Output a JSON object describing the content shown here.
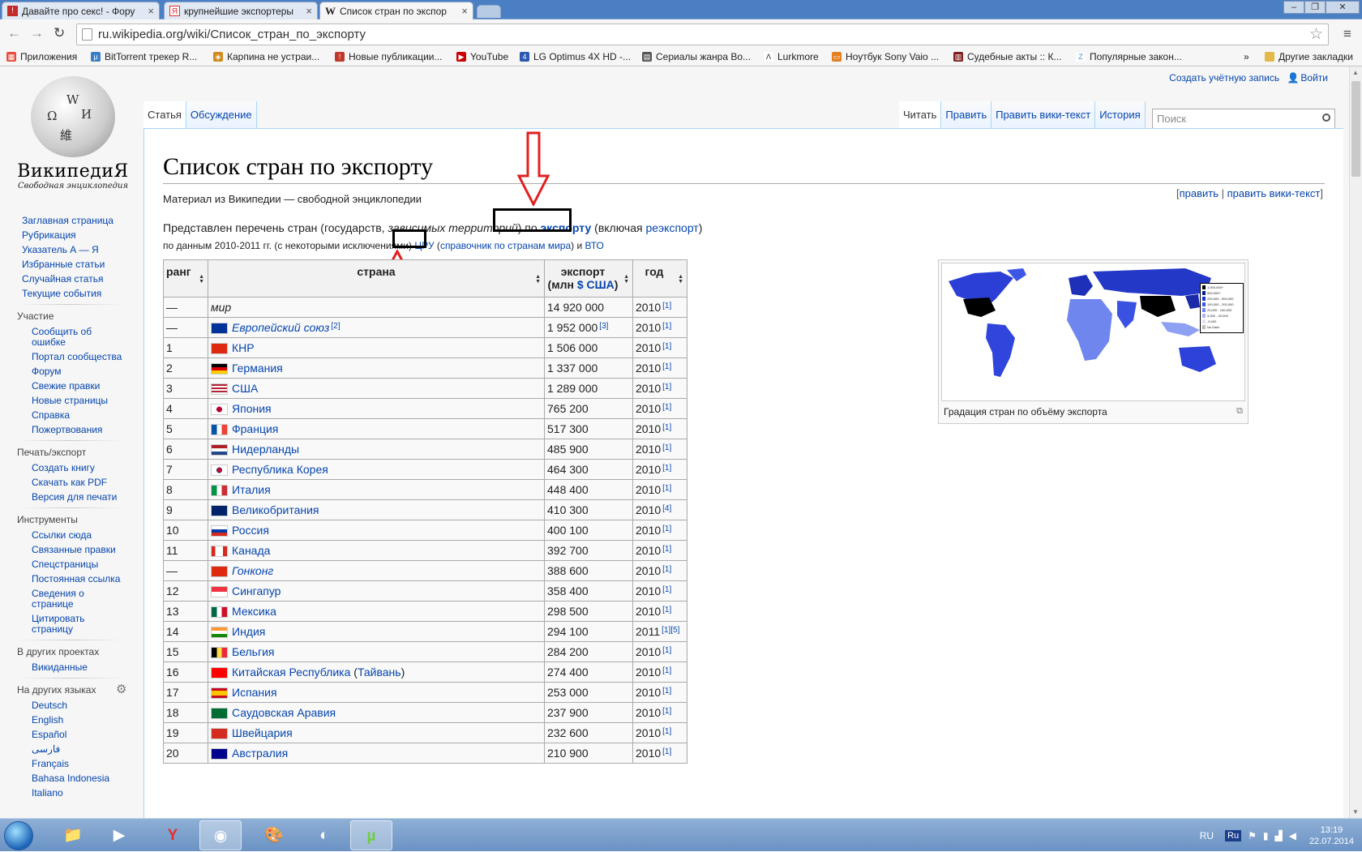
{
  "browser": {
    "tabs": [
      {
        "title": "Давайте про секс! - Фору",
        "icon": "forum-icon",
        "color": "#c42c2c"
      },
      {
        "title": "крупнейшие экспортеры",
        "icon": "yandex-icon",
        "color": "#e62e2e"
      },
      {
        "title": "Список стран по экспор",
        "icon": "wikipedia-icon",
        "color": "#333333"
      }
    ],
    "url": "ru.wikipedia.org/wiki/Список_стран_по_экспорту",
    "bookmarks": [
      {
        "label": "Приложения",
        "color": "#e74c3c"
      },
      {
        "label": "BitTorrent трекер R...",
        "color": "#3a7ec8"
      },
      {
        "label": "Карпина не устраи...",
        "color": "#d08a20"
      },
      {
        "label": "Новые публикации...",
        "color": "#c0392b"
      },
      {
        "label": "YouTube",
        "color": "#cc0000"
      },
      {
        "label": "LG Optimus 4X HD -...",
        "color": "#2a58b0"
      },
      {
        "label": "Сериалы жанра Во...",
        "color": "#555555"
      },
      {
        "label": "Lurkmore",
        "color": "#222222"
      },
      {
        "label": "Ноутбук Sony Vaio ...",
        "color": "#e67e22"
      },
      {
        "label": "Судебные акты :: К...",
        "color": "#7f1d1d"
      },
      {
        "label": "Популярные закон...",
        "color": "#3d8be0"
      }
    ],
    "bookmarks_more": "»",
    "other_bookmarks": "Другие закладки"
  },
  "sidebar": {
    "logo_wordmark": "ВикипедиЯ",
    "logo_tagline": "Свободная энциклопедия",
    "main": [
      "Заглавная страница",
      "Рубрикация",
      "Указатель А — Я",
      "Избранные статьи",
      "Случайная статья",
      "Текущие события"
    ],
    "participation_header": "Участие",
    "participation": [
      "Сообщить об ошибке",
      "Портал сообщества",
      "Форум",
      "Свежие правки",
      "Новые страницы",
      "Справка",
      "Пожертвования"
    ],
    "print_header": "Печать/экспорт",
    "print": [
      "Создать книгу",
      "Скачать как PDF",
      "Версия для печати"
    ],
    "tools_header": "Инструменты",
    "tools": [
      "Ссылки сюда",
      "Связанные правки",
      "Спецстраницы",
      "Постоянная ссылка",
      "Сведения о странице",
      "Цитировать страницу"
    ],
    "other_projects_header": "В других проектах",
    "other_projects": [
      "Викиданные"
    ],
    "languages_header": "На других языках",
    "languages": [
      "Deutsch",
      "English",
      "Español",
      "فارسی",
      "Français",
      "Bahasa Indonesia",
      "Italiano"
    ]
  },
  "header": {
    "create_account": "Создать учётную запись",
    "login": "Войти",
    "tab_article": "Статья",
    "tab_talk": "Обсуждение",
    "tab_read": "Читать",
    "tab_edit": "Править",
    "tab_edit_source": "Править вики-текст",
    "tab_history": "История",
    "search_placeholder": "Поиск"
  },
  "article": {
    "title": "Список стран по экспорту",
    "site_sub": "Материал из Википедии — свободной энциклопедии",
    "edit_open": "[",
    "edit_link": "править",
    "edit_sep": " | ",
    "edit_source_link": "править вики-текст",
    "edit_close": "]",
    "intro_a": "Представлен перечень стран (государств, ",
    "intro_b": "зависимых территорий",
    "intro_c": ") по ",
    "intro_link": "экспорту",
    "intro_d": " (включая ",
    "intro_link2": "реэкспорт",
    "intro_e": ")",
    "intro2_a": "по данным 2010-2011 гг. (с некоторыми исключениями) ",
    "intro2_link1": "ЦРУ",
    "intro2_b": " (",
    "intro2_link2": "справочник по странам мира",
    "intro2_c": ") и ",
    "intro2_link3": "ВТО",
    "table_headers": {
      "rank": "ранг",
      "country": "страна",
      "export_a": "экспорт",
      "export_b": "(млн ",
      "export_link": "$ США",
      "export_c": ")",
      "year": "год"
    },
    "rows": [
      {
        "rank": "—",
        "country": "мир",
        "flag": "",
        "italic": true,
        "plain": true,
        "value": "14 920 000",
        "vnote": "",
        "year": "2010",
        "ref": "[1]"
      },
      {
        "rank": "—",
        "country": "Европейский союз",
        "flag": "eu",
        "italic": true,
        "plain": false,
        "value": "1 952 000",
        "vnote": "[3]",
        "year": "2010",
        "ref": "[1]",
        "cnote": "[2]"
      },
      {
        "rank": "1",
        "country": "КНР",
        "flag": "cn",
        "value": "1 506 000",
        "year": "2010",
        "ref": "[1]"
      },
      {
        "rank": "2",
        "country": "Германия",
        "flag": "de",
        "value": "1 337 000",
        "year": "2010",
        "ref": "[1]"
      },
      {
        "rank": "3",
        "country": "США",
        "flag": "us",
        "value": "1 289 000",
        "year": "2010",
        "ref": "[1]"
      },
      {
        "rank": "4",
        "country": "Япония",
        "flag": "jp",
        "value": "765 200",
        "year": "2010",
        "ref": "[1]"
      },
      {
        "rank": "5",
        "country": "Франция",
        "flag": "fr",
        "value": "517 300",
        "year": "2010",
        "ref": "[1]"
      },
      {
        "rank": "6",
        "country": "Нидерланды",
        "flag": "nl",
        "value": "485 900",
        "year": "2010",
        "ref": "[1]"
      },
      {
        "rank": "7",
        "country": "Республика Корея",
        "flag": "kr",
        "value": "464 300",
        "year": "2010",
        "ref": "[1]"
      },
      {
        "rank": "8",
        "country": "Италия",
        "flag": "it",
        "value": "448 400",
        "year": "2010",
        "ref": "[1]"
      },
      {
        "rank": "9",
        "country": "Великобритания",
        "flag": "gb",
        "value": "410 300",
        "year": "2010",
        "ref": "[4]"
      },
      {
        "rank": "10",
        "country": "Россия",
        "flag": "ru",
        "value": "400 100",
        "year": "2010",
        "ref": "[1]"
      },
      {
        "rank": "11",
        "country": "Канада",
        "flag": "ca",
        "value": "392 700",
        "year": "2010",
        "ref": "[1]"
      },
      {
        "rank": "—",
        "country": "Гонконг",
        "flag": "hk",
        "italic": true,
        "value": "388 600",
        "year": "2010",
        "ref": "[1]"
      },
      {
        "rank": "12",
        "country": "Сингапур",
        "flag": "sg",
        "value": "358 400",
        "year": "2010",
        "ref": "[1]"
      },
      {
        "rank": "13",
        "country": "Мексика",
        "flag": "mx",
        "value": "298 500",
        "year": "2010",
        "ref": "[1]"
      },
      {
        "rank": "14",
        "country": "Индия",
        "flag": "in",
        "value": "294 100",
        "year": "2011",
        "ref": "[1][5]"
      },
      {
        "rank": "15",
        "country": "Бельгия",
        "flag": "be",
        "value": "284 200",
        "year": "2010",
        "ref": "[1]"
      },
      {
        "rank": "16",
        "country": "Китайская Республика",
        "country_extra_link": "Тайвань",
        "flag": "tw",
        "value": "274 400",
        "year": "2010",
        "ref": "[1]"
      },
      {
        "rank": "17",
        "country": "Испания",
        "flag": "es",
        "value": "253 000",
        "year": "2010",
        "ref": "[1]"
      },
      {
        "rank": "18",
        "country": "Саудовская Аравия",
        "flag": "sa",
        "value": "237 900",
        "year": "2010",
        "ref": "[1]"
      },
      {
        "rank": "19",
        "country": "Швейцария",
        "flag": "ch",
        "value": "232 600",
        "year": "2010",
        "ref": "[1]"
      },
      {
        "rank": "20",
        "country": "Австралия",
        "flag": "au",
        "value": "210 900",
        "year": "2010",
        "ref": "[1]"
      }
    ],
    "thumb_caption": "Градация стран по объёму экспорта",
    "map_legend": [
      "1,000,000+",
      "500,000+",
      "200,000 - 500,000",
      "100,000 - 200,000",
      "20,000 - 100,000",
      "5,000 - 20,000",
      "-5,000",
      "No Data"
    ]
  },
  "taskbar": {
    "lang": "RU",
    "time": "13:19",
    "date": "22.07.2014"
  },
  "colors": {
    "link": "#0645ad",
    "annotation_red": "#e02020",
    "map_dark": "#0a1a8c"
  }
}
